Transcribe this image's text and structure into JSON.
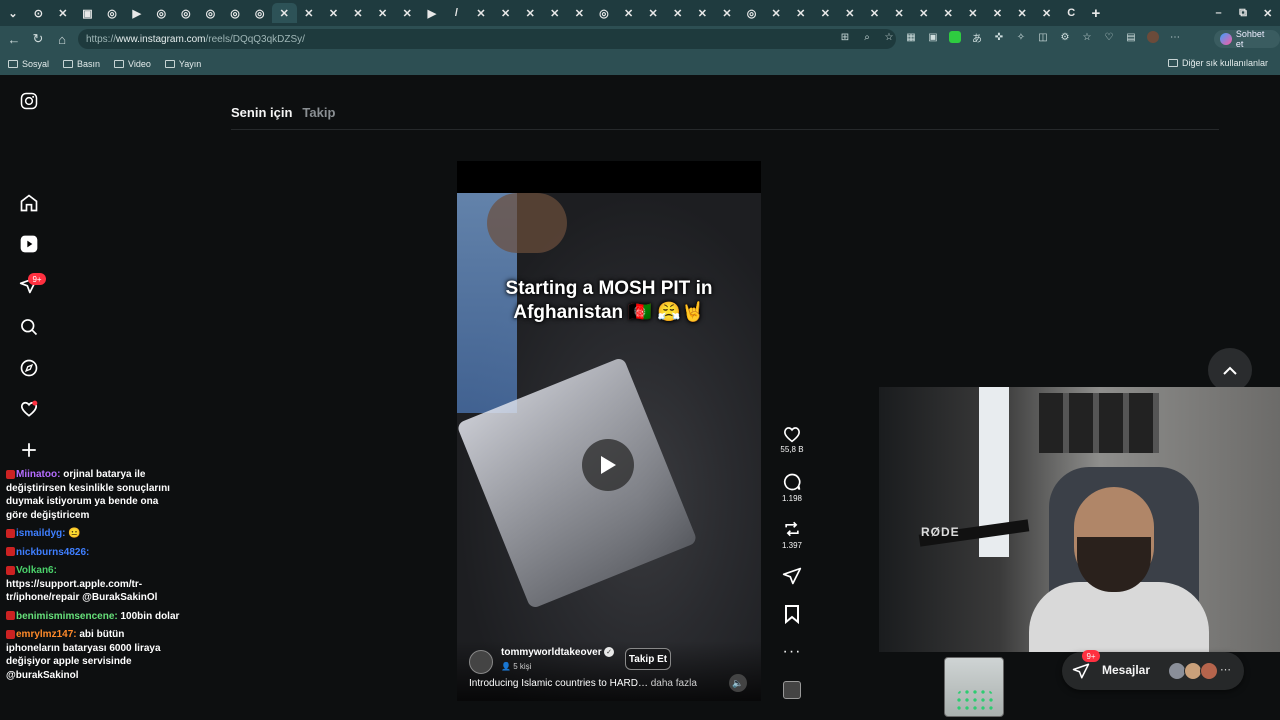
{
  "browser": {
    "tabs": [
      "⊙",
      "✕",
      "▣",
      "◎",
      "▶",
      "◎",
      "◎",
      "◎",
      "◎",
      "◎",
      "✕",
      "✕",
      "✕",
      "✕",
      "✕",
      "✕",
      "▶",
      "/",
      "✕",
      "✕",
      "✕",
      "✕",
      "✕",
      "◎",
      "✕",
      "✕",
      "✕",
      "✕",
      "✕",
      "◎",
      "✕",
      "✕",
      "✕",
      "✕",
      "✕",
      "✕",
      "✕",
      "✕",
      "✕",
      "✕",
      "✕",
      "✕",
      "C"
    ],
    "url_prefix": "https://",
    "url_host": "www.instagram.com",
    "url_path": "/reels/DQqQ3qkDZSy/",
    "copilot_label": "Sohbet et",
    "bookmarks": [
      "Sosyal",
      "Basın",
      "Video",
      "Yayın"
    ],
    "bookmarks_other": "Diğer sık kullanılanlar"
  },
  "instagram": {
    "tabs": {
      "for_you": "Senin için",
      "following": "Takip"
    },
    "nav_badge": "9+",
    "reel": {
      "overlay_line1": "Starting a MOSH PIT in",
      "overlay_line2": "Afghanistan 🇦🇫 😤🤘",
      "username": "tommyworldtakeover",
      "followers": "5 kişi",
      "follow_label": "Takip Et",
      "caption": "Introducing Islamic countries to HARD…",
      "caption_more": "daha fazla"
    },
    "actions": {
      "likes": "55,8 B",
      "comments": "1.198",
      "reposts": "1.397"
    },
    "messages": {
      "label": "Mesajlar",
      "badge": "9+"
    }
  },
  "chat": [
    {
      "user": "Miinatoo:",
      "user_color": "#b56cff",
      "text": "orjinal batarya ile değiştirirsen kesinlikle sonuçlarını duymak istiyorum ya bende ona göre değiştiricem"
    },
    {
      "user": "ismaildyg:",
      "user_color": "#3f7fff",
      "text": "😐"
    },
    {
      "user": "nickburns4826:",
      "user_color": "#3f7fff",
      "text": ""
    },
    {
      "user": "Volkan6:",
      "user_color": "#4ad06a",
      "text": "https://support.apple.com/tr-tr/iphone/repair @BurakSakinOl"
    },
    {
      "user": "benimismimsencene:",
      "user_color": "#66e07a",
      "text": "100bin dolar"
    },
    {
      "user": "emrylmz147:",
      "user_color": "#ff8a2a",
      "text": "abi bütün iphoneların bataryası 6000 liraya değişiyor apple servisinde @burakSakinol"
    }
  ],
  "webcam": {
    "mic_brand": "RØDE"
  }
}
